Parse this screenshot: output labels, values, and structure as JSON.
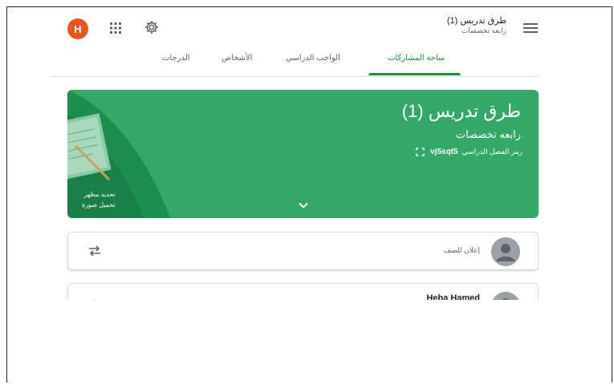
{
  "header": {
    "avatar_letter": "H",
    "class_title": "طرق تدريس (1)",
    "class_subtitle": "رابعه تخصصات",
    "icons": [
      "apps-icon",
      "gear-icon",
      "menu-icon"
    ]
  },
  "tabs": [
    {
      "label": "ساحة المشاركات",
      "active": true
    },
    {
      "label": "الواجب الدراسي",
      "active": false
    },
    {
      "label": "الأشخاص",
      "active": false
    },
    {
      "label": "الدرجات",
      "active": false
    }
  ],
  "banner": {
    "title": "طرق تدريس (1)",
    "subtitle": "رابعه تخصصات",
    "code_label": "رمز الفصل الدراسي",
    "code_value": "vj5sqt5",
    "customize_label": "تحديد مظهر",
    "upload_label": "تحميل صورة"
  },
  "announce": {
    "placeholder": "إعلان للصف"
  },
  "post": {
    "author": "Heba Hamed"
  },
  "colors": {
    "accent": "#1e8e3e",
    "banner": "#34a869",
    "avatar": "#e8541d"
  }
}
